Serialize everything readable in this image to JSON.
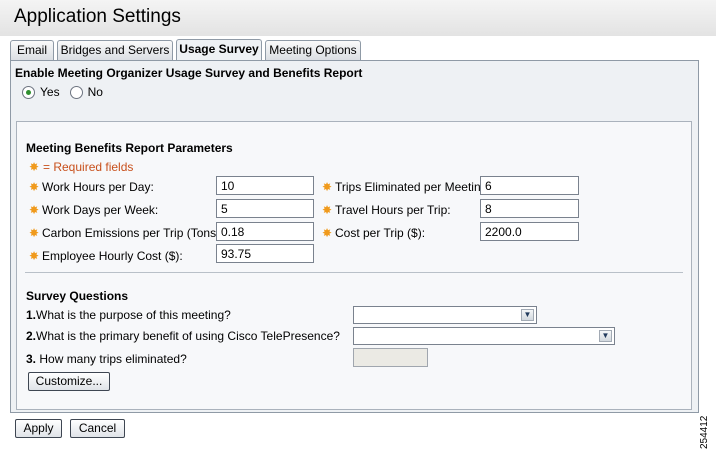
{
  "page": {
    "title": "Application Settings",
    "figure_id": "254412"
  },
  "tabs": [
    {
      "label": "Email",
      "active": false
    },
    {
      "label": "Bridges and Servers",
      "active": false
    },
    {
      "label": "Usage Survey",
      "active": true
    },
    {
      "label": "Meeting Options",
      "active": false
    }
  ],
  "enable": {
    "title": "Enable Meeting Organizer Usage Survey and Benefits Report",
    "yes_label": "Yes",
    "no_label": "No",
    "selected": "Yes"
  },
  "report": {
    "title": "Meeting Benefits Report Parameters",
    "required_note": "= Required fields",
    "fields": {
      "work_hours": {
        "label": "Work Hours per Day:",
        "value": "10"
      },
      "work_days": {
        "label": "Work Days per Week:",
        "value": "5"
      },
      "carbon": {
        "label": "Carbon Emissions per Trip (Tons):",
        "value": "0.18"
      },
      "hourly_cost": {
        "label": "Employee Hourly Cost ($):",
        "value": "93.75"
      },
      "trips_eliminated": {
        "label": "Trips Eliminated per Meeting:",
        "value": "6"
      },
      "travel_hours": {
        "label": "Travel Hours per Trip:",
        "value": "8"
      },
      "cost_per_trip": {
        "label": "Cost per Trip ($):",
        "value": "2200.0"
      }
    }
  },
  "survey": {
    "title": "Survey Questions",
    "q1": {
      "number": "1.",
      "text": "What is the purpose of this meeting?"
    },
    "q2": {
      "number": "2.",
      "text": "What is the primary benefit of using Cisco TelePresence?"
    },
    "q3": {
      "number": "3.",
      "text": " How many trips eliminated?"
    },
    "customize_label": "Customize..."
  },
  "actions": {
    "apply_label": "Apply",
    "cancel_label": "Cancel"
  },
  "colors": {
    "required_text": "#c8501c",
    "required_star": "#f09a1c",
    "radio_dot": "#2f8f2f"
  },
  "icons": {
    "required": "required-star-icon",
    "dropdown": "chevron-down-icon"
  }
}
